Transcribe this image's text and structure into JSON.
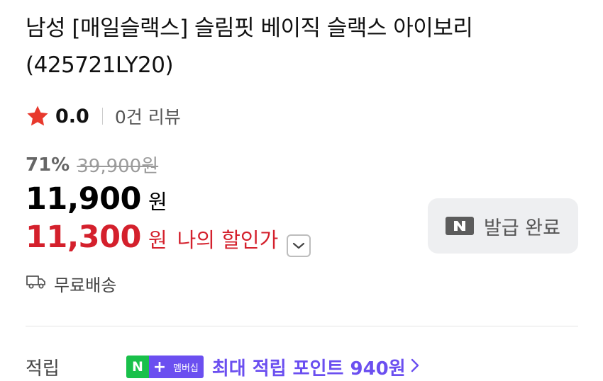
{
  "product": {
    "title": "남성 [매일슬랙스] 슬림핏 베이직 슬랙스 아이보리 (425721LY20)",
    "rating": "0.0",
    "review_count": "0건 리뷰"
  },
  "price": {
    "discount_rate": "71%",
    "original_price": "39,900원",
    "sale_price": "11,900",
    "sale_unit": "원",
    "my_price": "11,300",
    "my_unit": "원",
    "my_label": "나의 할인가"
  },
  "coupon": {
    "badge": "N",
    "label": "발급 완료"
  },
  "shipping": {
    "label": "무료배송"
  },
  "points": {
    "label": "적립",
    "badge_n": "N",
    "badge_plus": "+",
    "badge_member": "멤버십",
    "text": "최대 적립 포인트 940원"
  },
  "colors": {
    "accent_red": "#d4202c",
    "star": "#e8392d",
    "npay_green": "#19c04a",
    "npay_purple": "#6b4ff0"
  },
  "icons": {
    "rating": "star-icon",
    "dropdown": "chevron-down-icon",
    "coupon": "naver-n-icon",
    "shipping": "truck-icon",
    "points": "chevron-right-icon"
  }
}
